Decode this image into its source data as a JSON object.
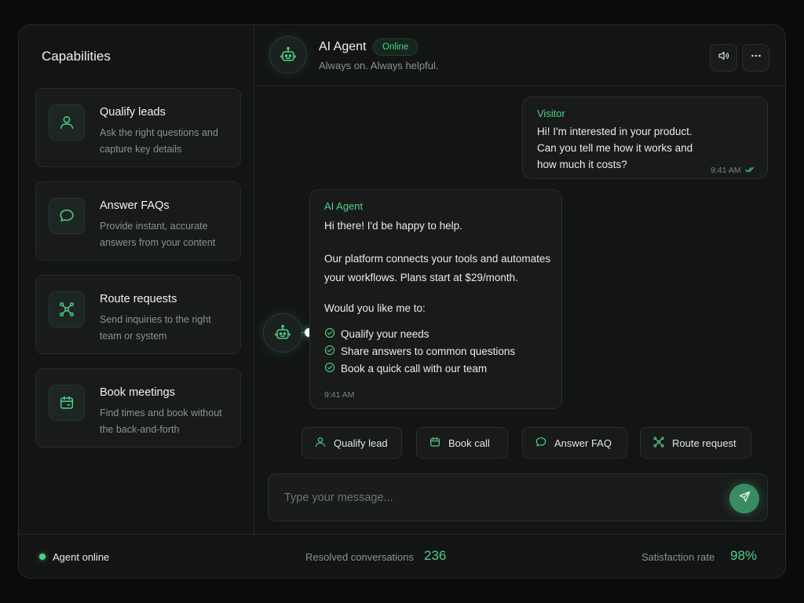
{
  "sidebar": {
    "title": "Capabilities",
    "items": [
      {
        "title": "Qualify leads",
        "desc": "Ask the right questions and capture key details",
        "icon": "user-icon"
      },
      {
        "title": "Answer FAQs",
        "desc": "Provide instant, accurate answers from your content",
        "icon": "chat-bubble-icon"
      },
      {
        "title": "Route requests",
        "desc": "Send inquiries to the right team or system",
        "icon": "route-icon"
      },
      {
        "title": "Book meetings",
        "desc": "Find times and book without the back-and-forth",
        "icon": "calendar-icon"
      }
    ]
  },
  "header": {
    "name": "AI Agent",
    "status": "Online",
    "subtitle": "Always on. Always helpful."
  },
  "messages": {
    "visitor": {
      "sender": "Visitor",
      "text": "Hi! I'm interested in your product. Can you tell me how it works and how much it costs?",
      "time": "9:41 AM"
    },
    "agent": {
      "sender": "AI Agent",
      "greeting": "Hi there! I'd be happy to help.",
      "body": "Our platform connects your tools and automates your workflows. Plans start at $29/month.",
      "question": "Would you like me to:",
      "options": [
        "Qualify your needs",
        "Share answers to common questions",
        "Book a quick call with our team"
      ],
      "time": "9:41 AM"
    }
  },
  "quick_actions": [
    "Qualify lead",
    "Book call",
    "Answer FAQ",
    "Route request"
  ],
  "composer": {
    "placeholder": "Type your message..."
  },
  "footer": {
    "status": "Agent online",
    "resolved_label": "Resolved conversations",
    "resolved_value": "236",
    "satisfaction_label": "Satisfaction rate",
    "satisfaction_value": "98%"
  },
  "colors": {
    "accent": "#4fd08a",
    "background": "#0a0b0a",
    "panel": "#131514"
  }
}
